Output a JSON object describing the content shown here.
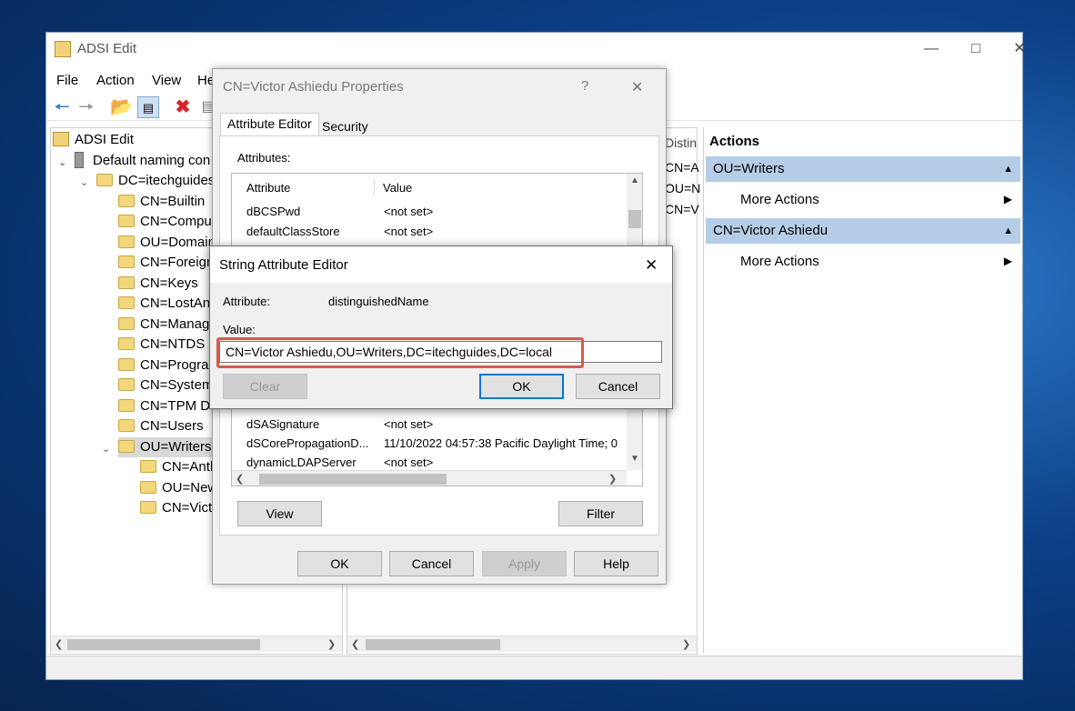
{
  "main_window": {
    "title": "ADSI Edit",
    "menu": [
      "File",
      "Action",
      "View",
      "He"
    ],
    "toolbar_icons": [
      "back-arrow-icon",
      "forward-arrow-icon",
      "up-folder-icon",
      "show-hide-tree-icon",
      "delete-icon",
      "properties-icon"
    ]
  },
  "tree": {
    "root": "ADSI Edit",
    "naming_context": "Default naming con",
    "domain": "DC=itechguides",
    "items": [
      "CN=Builtin",
      "CN=Comput",
      "OU=Domain",
      "CN=Foreign",
      "CN=Keys",
      "CN=LostAnd",
      "CN=Manag",
      "CN=NTDS C",
      "CN=Progra",
      "CN=System",
      "CN=TPM De",
      "CN=Users",
      "OU=Writers"
    ],
    "children": [
      "CN=Anth",
      "OU=New",
      "CN=Victo"
    ]
  },
  "middle_pane": {
    "header": "Distin",
    "rows": [
      "CN=A",
      "OU=N",
      "CN=V"
    ]
  },
  "actions": {
    "title": "Actions",
    "sections": [
      {
        "header": "OU=Writers",
        "item": "More Actions"
      },
      {
        "header": "CN=Victor Ashiedu",
        "item": "More Actions"
      }
    ]
  },
  "properties_dialog": {
    "title": "CN=Victor Ashiedu Properties",
    "help": "?",
    "close": "✕",
    "tabs": [
      "Attribute Editor",
      "Security"
    ],
    "attributes_label": "Attributes:",
    "columns": [
      "Attribute",
      "Value"
    ],
    "rows_top": [
      {
        "attr": "dBCSPwd",
        "value": "<not set>"
      },
      {
        "attr": "defaultClassStore",
        "value": "<not set>"
      }
    ],
    "rows_bottom": [
      {
        "attr": "dSASignature",
        "value": "<not set>"
      },
      {
        "attr": "dSCorePropagationD...",
        "value": "11/10/2022 04:57:38 Pacific Daylight Time; 0"
      },
      {
        "attr": "dynamicLDAPServer",
        "value": "<not set>"
      }
    ],
    "view_button": "View",
    "filter_button": "Filter",
    "ok_button": "OK",
    "cancel_button": "Cancel",
    "apply_button": "Apply",
    "help_button": "Help"
  },
  "string_editor": {
    "title": "String Attribute Editor",
    "close": "✕",
    "attribute_label": "Attribute:",
    "attribute_value": "distinguishedName",
    "value_label": "Value:",
    "value": "CN=Victor Ashiedu,OU=Writers,DC=itechguides,DC=local",
    "clear_button": "Clear",
    "ok_button": "OK",
    "cancel_button": "Cancel",
    "highlight_color": "#d45c4a"
  }
}
